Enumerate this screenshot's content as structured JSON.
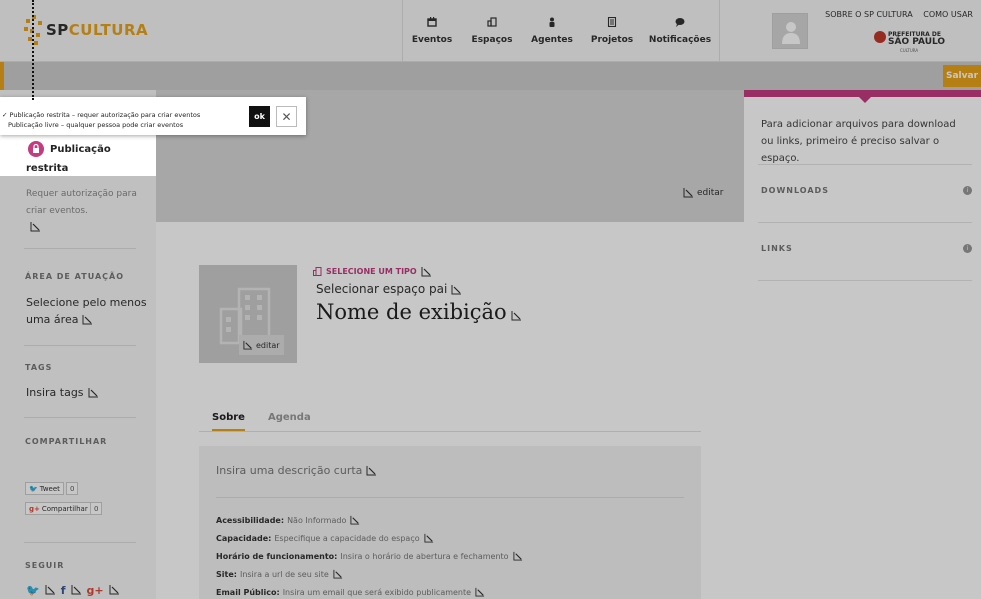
{
  "header": {
    "logo_sp": "SP",
    "logo_cultura": "CULTURA",
    "nav": [
      {
        "label": "Eventos",
        "icon": "calendar-icon"
      },
      {
        "label": "Espaços",
        "icon": "building-icon"
      },
      {
        "label": "Agentes",
        "icon": "person-icon"
      },
      {
        "label": "Projetos",
        "icon": "document-icon"
      },
      {
        "label": "Notificações",
        "icon": "speech-bubble-icon"
      }
    ],
    "links": [
      "SOBRE O SP CULTURA",
      "COMO USAR"
    ],
    "prefeitura": {
      "line1": "PREFEITURA DE",
      "line2": "SÃO PAULO",
      "line3": "CULTURA"
    }
  },
  "toolbar": {
    "save_label": "Salvar"
  },
  "popover": {
    "options": [
      "✓ Publicação restrita – requer autorização para criar eventos",
      "Publicação livre – qualquer pessoa pode criar eventos"
    ],
    "ok_label": "ok",
    "close_symbol": "✕"
  },
  "sidebar": {
    "publication_title_1": "Publicação",
    "publication_title_2": "restrita",
    "publication_desc_1": "Requer autorização para",
    "publication_desc_2": "criar eventos.",
    "area_heading": "ÁREA DE ATUAÇÃO",
    "area_value_1": "Selecione pelo menos",
    "area_value_2": "uma área",
    "tags_heading": "TAGS",
    "tags_value": "Insira tags",
    "share_heading": "COMPARTILHAR",
    "tweet_label": "Tweet",
    "tweet_count": "0",
    "gplus_label": "Compartilhar",
    "gplus_count": "0",
    "follow_heading": "SEGUIR"
  },
  "cover": {
    "edit_label": "editar"
  },
  "profile": {
    "thumb_edit_label": "editar",
    "type_label": "SELECIONE UM TIPO",
    "parent_label": "Selecionar espaço pai",
    "name_label": "Nome de exibição"
  },
  "tabs": [
    {
      "label": "Sobre",
      "active": true
    },
    {
      "label": "Agenda",
      "active": false
    }
  ],
  "details": {
    "short_desc": "Insira uma descrição curta",
    "fields": [
      {
        "label": "Acessibilidade:",
        "value": "Não Informado"
      },
      {
        "label": "Capacidade:",
        "value": "Especifique a capacidade do espaço"
      },
      {
        "label": "Horário de funcionamento:",
        "value": "Insira o horário de abertura e fechamento"
      },
      {
        "label": "Site:",
        "value": "Insira a url de seu site"
      },
      {
        "label": "Email Público:",
        "value": "Insira um email que será exibido publicamente"
      }
    ]
  },
  "right": {
    "note": "Para adicionar arquivos para download ou links, primeiro é preciso salvar o espaço.",
    "downloads_heading": "DOWNLOADS",
    "links_heading": "LINKS"
  },
  "colors": {
    "accent": "#e8a31a",
    "pink": "#c43b80"
  }
}
